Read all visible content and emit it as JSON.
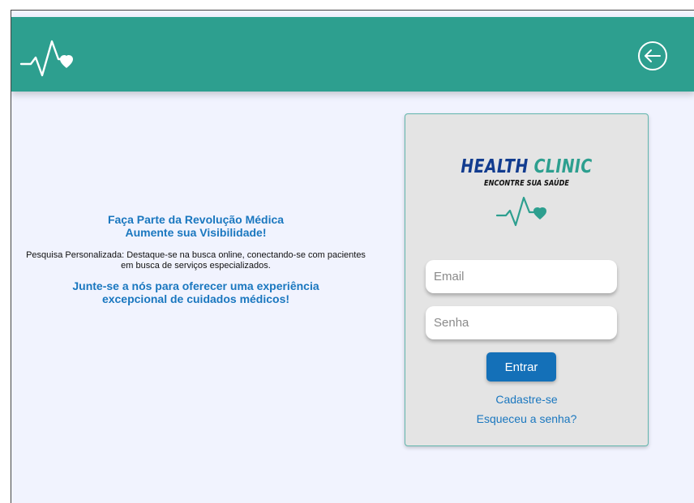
{
  "header": {
    "logo_icon": "heartbeat-heart-icon",
    "back_icon": "arrow-left-circle-icon",
    "bar_color": "#2d9f8f"
  },
  "promo": {
    "title_line1": "Faça Parte da Revolução Médica",
    "title_line2": "Aumente sua Visibilidade!",
    "body": "Pesquisa Personalizada: Destaque-se na busca online, conectando-se com pacientes em busca de serviços especializados.",
    "cta": "Junte-se a nós para oferecer uma experiência excepcional de cuidados médicos!"
  },
  "login": {
    "brand_word1": "HEALTH",
    "brand_word2": "CLINIC",
    "tagline": "ENCONTRE SUA SAÚDE",
    "email_placeholder": "Email",
    "password_placeholder": "Senha",
    "submit_label": "Entrar",
    "signup_link": "Cadastre-se",
    "forgot_link": "Esqueceu a senha?"
  },
  "colors": {
    "teal": "#2d9f8f",
    "blue_text": "#1a77bf",
    "button": "#1470b8",
    "brand_navy": "#123c8f",
    "background": "#f1f3fe"
  }
}
